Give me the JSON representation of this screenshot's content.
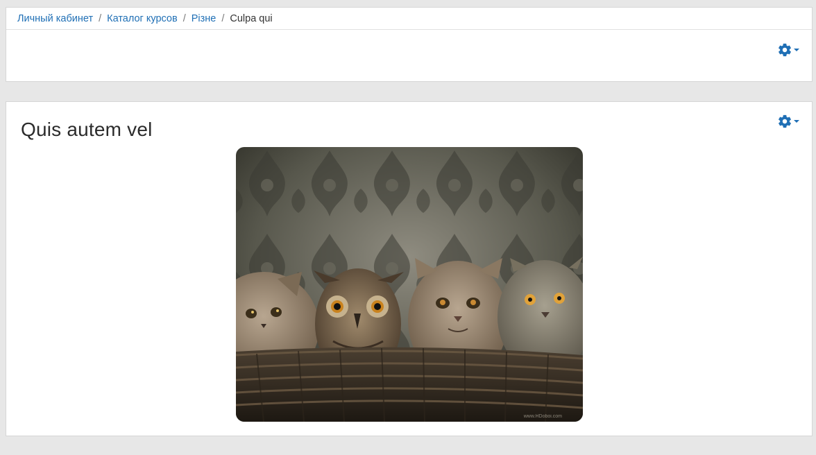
{
  "breadcrumb": {
    "items": [
      "Личный кабинет",
      "Каталог курсов",
      "Різне"
    ],
    "current": "Culpa qui",
    "separator": "/"
  },
  "settings_icon": "gear-icon",
  "dropdown_icon": "caret-down-icon",
  "main": {
    "title": "Quis autem vel",
    "image_watermark": "www.HDoboi.com"
  },
  "colors": {
    "link": "#1f6fb5",
    "gear": "#1f6fb5",
    "background": "#e7e7e7"
  }
}
